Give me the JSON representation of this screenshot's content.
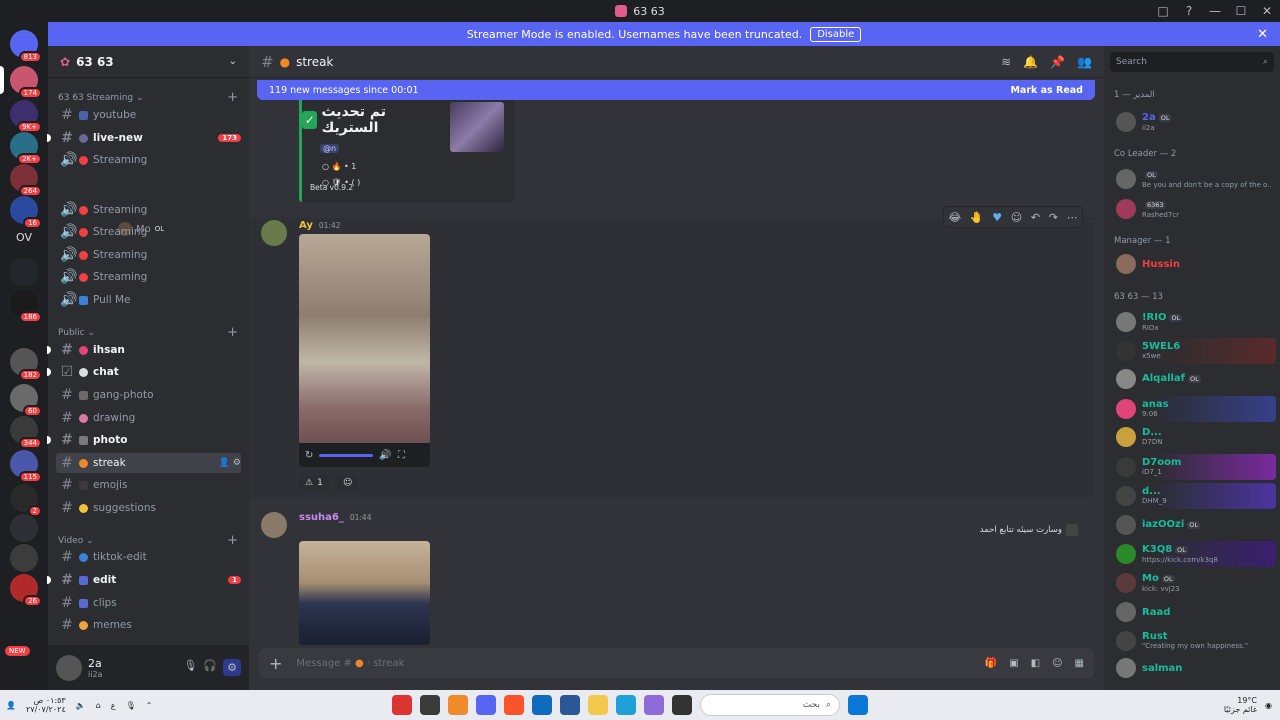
{
  "window": {
    "title": "63 63",
    "controls": [
      "□",
      "?",
      "—",
      "☐",
      "✕"
    ]
  },
  "banner": {
    "text": "Streamer Mode is enabled. Usernames have been truncated.",
    "button": "Disable"
  },
  "rail": {
    "badges": [
      "813",
      "174",
      "9K+",
      "2K+",
      "264",
      "16",
      "186",
      "182",
      "60",
      "344",
      "115",
      "2",
      "26"
    ],
    "text_server": "OV",
    "new_label": "NEW"
  },
  "server": {
    "name": "63 63"
  },
  "categories": {
    "streaming": "63 63 Streaming",
    "public": "Public",
    "video": "Video"
  },
  "channels": {
    "youtube": "youtube",
    "live_new": "live-new",
    "live_new_count": "173",
    "streaming": "Streaming",
    "stream_user": "Mo",
    "stream_user_tag": "OL",
    "pull_me": "Pull Me",
    "ihsan": "ihsan",
    "chat": "chat",
    "gang_photo": "gang-photo",
    "drawing": "drawing",
    "photo": "photo",
    "streak": "streak",
    "emojis": "emojis",
    "suggestions": "suggestions",
    "tiktok_edit": "tiktok-edit",
    "edit": "edit",
    "edit_count": "1",
    "clips": "clips",
    "memes": "memes"
  },
  "user_panel": {
    "name": "2a",
    "status": "ii2a"
  },
  "channel_header": {
    "name": "streak"
  },
  "new_messages": {
    "text": "119 new messages since 00:01",
    "mark_read": "Mark as Read"
  },
  "embed": {
    "title_ar": "تم تحديث الستريك",
    "mention": "@n",
    "line1": "1",
    "line2": "( )",
    "footer": "Beta v0.9.2"
  },
  "messages": [
    {
      "author": "Ay",
      "time": "01:42",
      "reaction_count": "1"
    },
    {
      "author": "ssuha6_",
      "time": "01:44",
      "text_ar": "وسارت سيئه تتابع احمد"
    }
  ],
  "composer": {
    "placeholder": "Message #",
    "channel": "streak"
  },
  "members": {
    "search_placeholder": "Search",
    "groups": [
      {
        "label": "المدير — 1"
      },
      {
        "label": "Co Leader — 2"
      },
      {
        "label": "Manager — 1"
      },
      {
        "label": "63 63 — 13"
      }
    ],
    "list": [
      {
        "name": "2a",
        "status": "ii2a",
        "tag": "OL",
        "color": "#5865f2"
      },
      {
        "name": "",
        "status": "Be you and don't be a copy of the o...",
        "tag": "OL",
        "color": "#dbdee1"
      },
      {
        "name": "",
        "status": "Rashed7cr",
        "tag": "6363",
        "color": "#dbdee1"
      },
      {
        "name": "Hussin",
        "status": "",
        "tag": "",
        "color": "#f23f43"
      },
      {
        "name": "!RIO",
        "status": "RIOx",
        "tag": "OL",
        "color": "#1abc9c"
      },
      {
        "name": "5WEL6",
        "status": "x5we",
        "tag": "",
        "color": "#1abc9c"
      },
      {
        "name": "Alqallaf",
        "status": "",
        "tag": "OL",
        "color": "#1abc9c"
      },
      {
        "name": "anas",
        "status": "9:06",
        "tag": "",
        "color": "#1abc9c"
      },
      {
        "name": "D...",
        "status": "D7DN",
        "tag": "",
        "color": "#1abc9c"
      },
      {
        "name": "D7oom",
        "status": "iD7_1",
        "tag": "",
        "color": "#1abc9c"
      },
      {
        "name": "d...",
        "status": "DHM_9",
        "tag": "",
        "color": "#1abc9c"
      },
      {
        "name": "iazOOzi",
        "status": "",
        "tag": "OL",
        "color": "#1abc9c"
      },
      {
        "name": "K3Q8",
        "status": "https://kick.com/k3q8",
        "tag": "OL",
        "color": "#1abc9c"
      },
      {
        "name": "Mo",
        "status": "kick: vvj23",
        "tag": "OL",
        "color": "#1abc9c"
      },
      {
        "name": "Raad",
        "status": "",
        "tag": "",
        "color": "#1abc9c"
      },
      {
        "name": "Rust",
        "status": "\"Creating my own happiness.\"",
        "tag": "",
        "color": "#1abc9c"
      },
      {
        "name": "salman",
        "status": "",
        "tag": "",
        "color": "#1abc9c"
      }
    ]
  },
  "taskbar": {
    "time_left": "٠١:٥٣ ص",
    "date_left": "٢٧/٠٧/٢٠٢٤",
    "lang": "ع",
    "search_placeholder": "بحث",
    "temp": "19°C",
    "weather_text": "غائم جزئيًا"
  }
}
